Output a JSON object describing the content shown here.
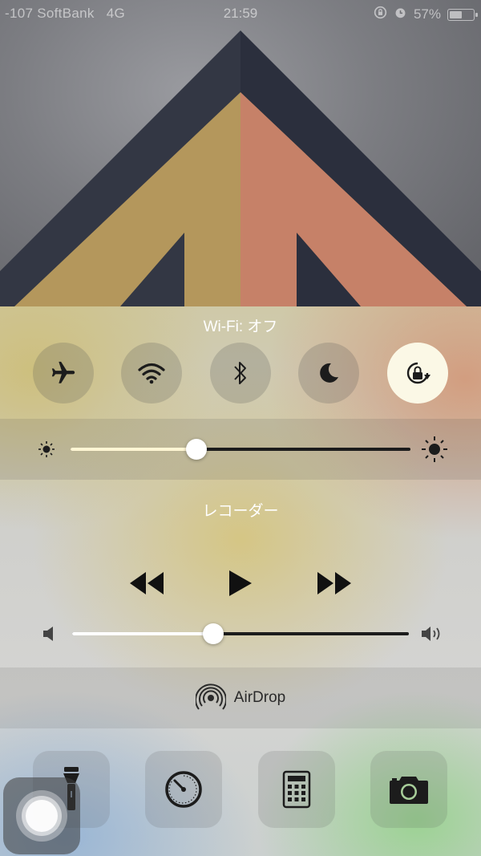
{
  "status_bar": {
    "carrier": "-107 SoftBank",
    "network": "4G",
    "time": "21:59",
    "battery_percent": "57%",
    "battery_level": 0.57
  },
  "control_center": {
    "wifi_status": "Wi-Fi: オフ",
    "toggles": [
      {
        "name": "airplane-mode",
        "icon": "airplane-icon",
        "active": false
      },
      {
        "name": "wifi",
        "icon": "wifi-icon",
        "active": false
      },
      {
        "name": "bluetooth",
        "icon": "bluetooth-icon",
        "active": false
      },
      {
        "name": "do-not-disturb",
        "icon": "moon-icon",
        "active": false
      },
      {
        "name": "rotation-lock",
        "icon": "rotation-lock-icon",
        "active": true
      }
    ],
    "brightness_level": 0.37,
    "now_playing": {
      "title": "レコーダー",
      "volume_level": 0.42
    },
    "airdrop_label": "AirDrop",
    "shortcuts": [
      {
        "name": "flashlight",
        "icon": "flashlight-icon"
      },
      {
        "name": "timer",
        "icon": "timer-icon"
      },
      {
        "name": "calculator",
        "icon": "calculator-icon"
      },
      {
        "name": "camera",
        "icon": "camera-icon"
      }
    ],
    "colors": {
      "active_toggle_bg": "#fbf8e6",
      "slider_fill": "#ffffff",
      "icon_dark": "#1c1c1c"
    }
  }
}
